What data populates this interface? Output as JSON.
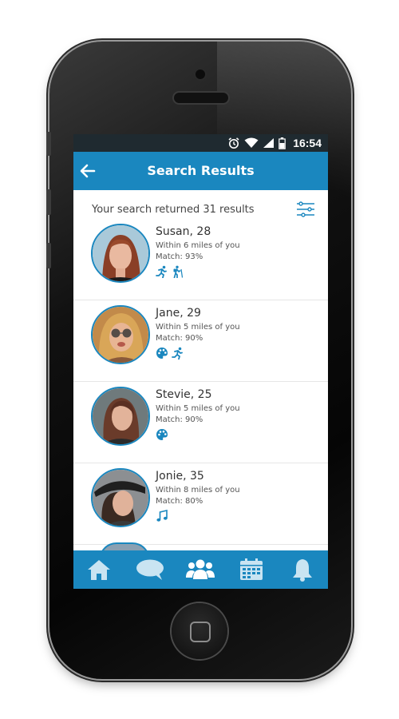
{
  "status_bar": {
    "time": "16:54",
    "icons": [
      "alarm-icon",
      "wifi-icon",
      "signal-icon",
      "battery-icon"
    ]
  },
  "header": {
    "title": "Search Results",
    "back_icon": "back-arrow-icon"
  },
  "summary": {
    "text": "Your search returned 31 results",
    "filter_icon": "filter-sliders-icon"
  },
  "results": [
    {
      "name": "Susan, 28",
      "distance": "Within 6 miles of you",
      "match": "Match: 93%",
      "interests": [
        "running-icon",
        "hiking-icon"
      ]
    },
    {
      "name": "Jane, 29",
      "distance": "Within 5 miles of you",
      "match": "Match: 90%",
      "interests": [
        "palette-icon",
        "running-icon"
      ]
    },
    {
      "name": "Stevie, 25",
      "distance": "Within 5 miles of you",
      "match": "Match: 90%",
      "interests": [
        "palette-icon"
      ]
    },
    {
      "name": "Jonie, 35",
      "distance": "Within 8 miles of you",
      "match": "Match: 80%",
      "interests": [
        "music-note-icon"
      ]
    }
  ],
  "bottom_nav": [
    "home-icon",
    "chat-icon",
    "people-icon",
    "calendar-icon",
    "bell-icon"
  ],
  "colors": {
    "primary": "#1a87bf",
    "active_nav": "#ffffff",
    "inactive_nav": "#c9e4f2",
    "status_bar": "#1f2a30"
  }
}
